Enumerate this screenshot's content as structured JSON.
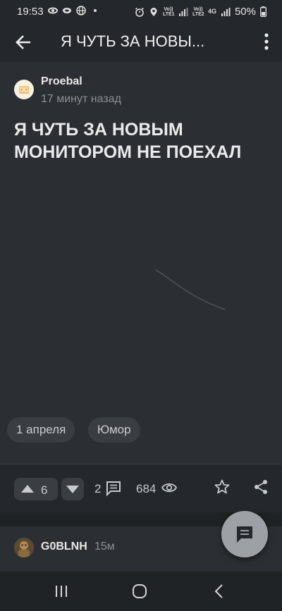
{
  "status_bar": {
    "time": "19:53",
    "battery": "50%",
    "sim1": "Vo)) LTE1",
    "sim2": "Vo)) LTE2",
    "network": "4G"
  },
  "app_bar": {
    "title": "Я ЧУТЬ ЗА НОВЫ...",
    "back_icon": "arrow-left-icon",
    "menu_icon": "more-vertical-icon"
  },
  "post": {
    "author": "Proebal",
    "time": "17 минут назад",
    "title": "Я ЧУТЬ ЗА НОВЫМ МОНИТОРОМ НЕ ПОЕХАЛ",
    "tags": [
      "1 апреля",
      "Юмор"
    ]
  },
  "actions": {
    "upvotes": "6",
    "comments": "2",
    "views": "684"
  },
  "comment": {
    "user": "G0BLNH",
    "time": "15м"
  },
  "colors": {
    "background": "#24282c",
    "card": "#2b2f33",
    "chip": "#3a3e43",
    "fab": "#9da0a4"
  }
}
